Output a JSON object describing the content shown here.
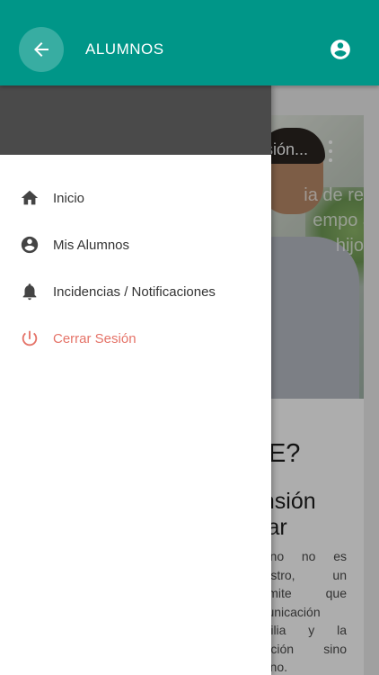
{
  "appbar": {
    "title": "ALUMNOS",
    "back_icon": "arrow-left-icon",
    "account_icon": "account-circle-icon",
    "color": "#009688"
  },
  "drawer": {
    "items": [
      {
        "label": "Inicio",
        "icon": "home-icon"
      },
      {
        "label": "Mis Alumnos",
        "icon": "account-circle-icon"
      },
      {
        "label": "Incidencias / Notificaciones",
        "icon": "bell-icon"
      },
      {
        "label": "Cerrar Sesión",
        "icon": "power-icon",
        "color": "#e57368"
      }
    ]
  },
  "background": {
    "video_title": "sión...",
    "video_overlay_text": "ia de res empo a hijos",
    "heading": "DE?",
    "subheading_line1": "ensión",
    "subheading_line2": "olar",
    "paragraph": "lumno no es registro, un permite que omunicación familia y la upación sino lumno."
  }
}
